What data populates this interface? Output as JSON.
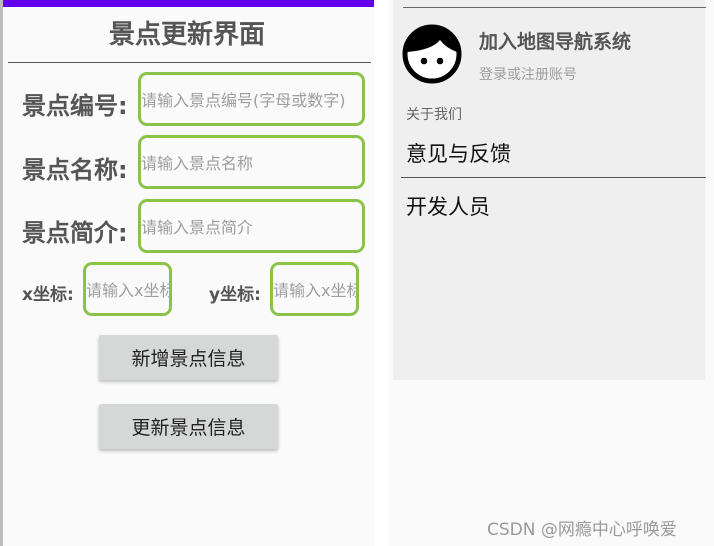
{
  "edit_screen": {
    "title": "景点更新界面",
    "fields": [
      {
        "label": "景点编号:",
        "placeholder": "请输入景点编号(字母或数字)"
      },
      {
        "label": "景点名称:",
        "placeholder": "请输入景点名称"
      },
      {
        "label": "景点简介:",
        "placeholder": "请输入景点简介"
      }
    ],
    "coords": {
      "x_label": "x坐标:",
      "x_placeholder": "请输入x坐标",
      "y_label": "y坐标:",
      "y_placeholder": "请输入x坐标"
    },
    "buttons": {
      "add": "新增景点信息",
      "update": "更新景点信息"
    }
  },
  "drawer": {
    "app_name": "加入地图导航系统",
    "login_hint": "登录或注册账号",
    "section_header": "关于我们",
    "menu_items": [
      "意见与反馈",
      "开发人员"
    ]
  },
  "watermark": "CSDN @网瘾中心呼唤爱",
  "colors": {
    "accent": "#6200ee",
    "input_border": "#8bc34a",
    "button_bg": "#d6d7d7",
    "drawer_bg": "#efefef"
  }
}
